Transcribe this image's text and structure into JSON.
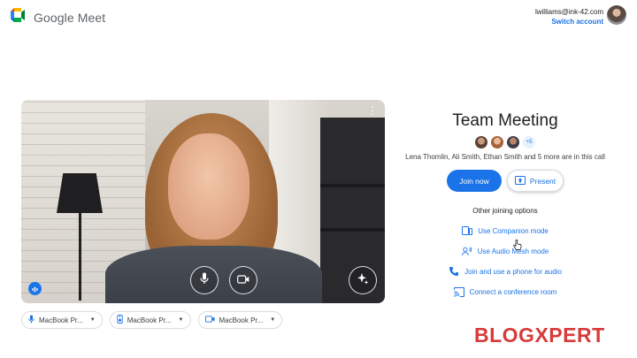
{
  "header": {
    "app_name": "Google Meet",
    "account_email": "lwilliams@ink-42.com",
    "switch_account": "Switch account"
  },
  "video": {
    "icons": {
      "mic": "mic-icon",
      "camera": "camera-icon",
      "effects": "sparkle-icon",
      "more": "more-vert-icon"
    }
  },
  "devices": [
    {
      "label": "MacBook Pr...",
      "icon": "mic-icon"
    },
    {
      "label": "MacBook Pr...",
      "icon": "speaker-icon"
    },
    {
      "label": "MacBook Pr...",
      "icon": "camera-icon"
    }
  ],
  "meeting": {
    "title": "Team Meeting",
    "extra_count": "+5",
    "participants_text": "Lena Thomlin, Ali Smith, Ethan Smith and 5 more are in this call",
    "join_label": "Join now",
    "present_label": "Present",
    "other_title": "Other joining options",
    "options": [
      {
        "label": "Use Companion mode",
        "icon": "companion-icon"
      },
      {
        "label": "Use Audio Mesh mode",
        "icon": "audio-mesh-icon"
      },
      {
        "label": "Join and use a phone for audio",
        "icon": "phone-icon"
      },
      {
        "label": "Connect a conference room",
        "icon": "cast-icon"
      }
    ]
  },
  "watermark": "BLOGXPERT",
  "colors": {
    "accent": "#1a73e8",
    "watermark": "#d83a3a"
  }
}
